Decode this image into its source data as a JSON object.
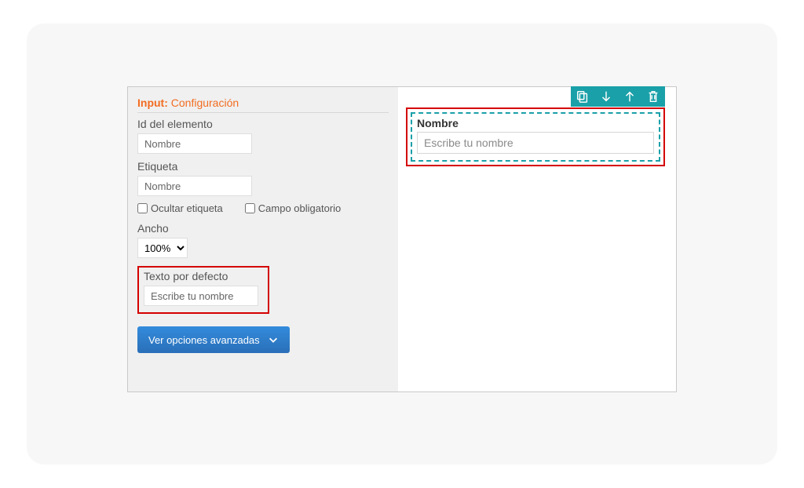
{
  "config": {
    "title_bold": "Input:",
    "title_normal": "Configuración",
    "id_label": "Id del elemento",
    "id_value": "Nombre",
    "etiqueta_label": "Etiqueta",
    "etiqueta_value": "Nombre",
    "ocultar_label": "Ocultar etiqueta",
    "obligatorio_label": "Campo obligatorio",
    "ancho_label": "Ancho",
    "ancho_value": "100%",
    "defecto_label": "Texto por defecto",
    "defecto_value": "Escribe tu nombre",
    "advanced_btn": "Ver opciones avanzadas"
  },
  "preview": {
    "field_label": "Nombre",
    "placeholder": "Escribe tu nombre"
  }
}
